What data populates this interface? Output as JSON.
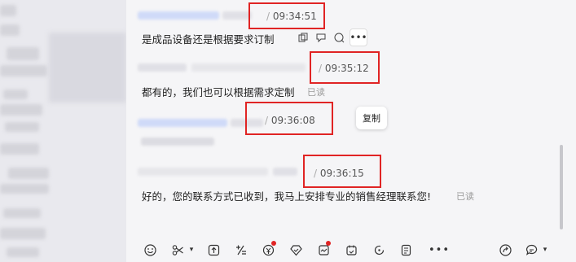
{
  "messages": [
    {
      "time": "09:34:51",
      "text": "是成品设备还是根据要求订制",
      "read": ""
    },
    {
      "time": "09:35:12",
      "text": "都有的，我们也可以根据需求定制",
      "read": "已读"
    },
    {
      "time": "09:36:08",
      "text": "",
      "read": ""
    },
    {
      "time": "09:36:15",
      "text": "好的，您的联系方式已收到，我马上安排专业的销售经理联系您!",
      "read": "已读"
    }
  ],
  "tooltip": {
    "copy": "复制"
  },
  "hover_tools": {
    "more": "•••"
  },
  "colors": {
    "highlight_red": "#e02424",
    "unread_dot": "#e02424",
    "background": "#f5f5f7",
    "name_blue": "#c9d6f7"
  },
  "toolbar_icons": [
    "emoji-icon",
    "scissors-icon",
    "upload-icon",
    "formula-icon",
    "redpacket-icon",
    "diamond-icon",
    "card-icon",
    "calendar-icon",
    "loop-icon",
    "doc-icon",
    "more-icon",
    "share-icon",
    "chat-bubble-icon"
  ]
}
